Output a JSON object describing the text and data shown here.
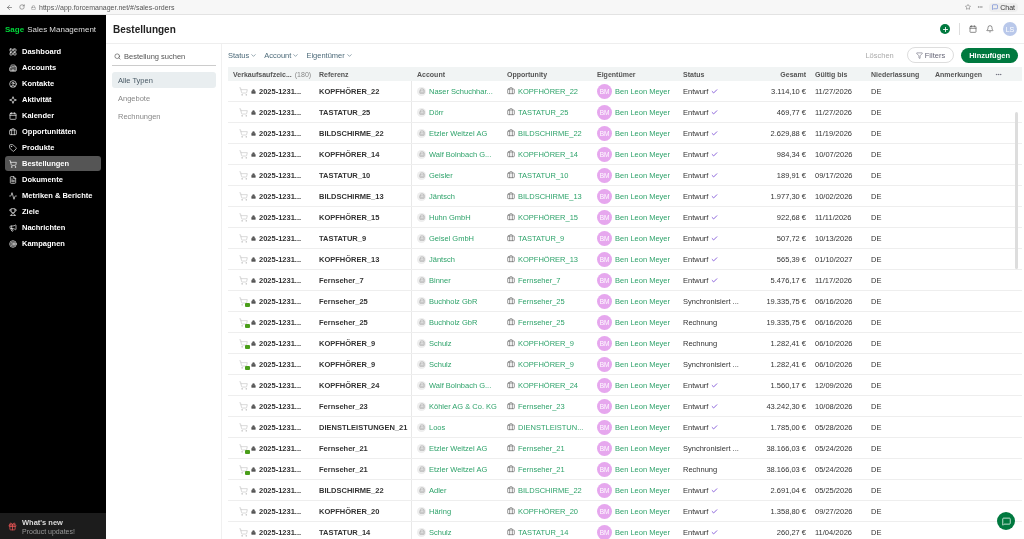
{
  "browser": {
    "url": "https://app.forcemanager.net/#/sales-orders",
    "chat_label": "Chat"
  },
  "sidebar": {
    "brand": "Sage",
    "product": "Sales Management",
    "items": [
      {
        "label": "Dashboard",
        "selected": false
      },
      {
        "label": "Accounts",
        "selected": false
      },
      {
        "label": "Kontakte",
        "selected": false
      },
      {
        "label": "Aktivität",
        "selected": false
      },
      {
        "label": "Kalender",
        "selected": false
      },
      {
        "label": "Opportunitäten",
        "selected": false
      },
      {
        "label": "Produkte",
        "selected": false
      },
      {
        "label": "Bestellungen",
        "selected": true
      },
      {
        "label": "Dokumente",
        "selected": false
      },
      {
        "label": "Metriken & Berichte",
        "selected": false
      },
      {
        "label": "Ziele",
        "selected": false
      },
      {
        "label": "Nachrichten",
        "selected": false
      },
      {
        "label": "Kampagnen",
        "selected": false
      }
    ],
    "whats_new": {
      "title": "What's new",
      "subtitle": "Product updates!"
    }
  },
  "header": {
    "title": "Bestellungen",
    "avatar": "LS"
  },
  "search": {
    "placeholder": "Bestellung suchen"
  },
  "types": [
    {
      "label": "Alle Typen",
      "selected": true
    },
    {
      "label": "Angebote",
      "selected": false
    },
    {
      "label": "Rechnungen",
      "selected": false
    }
  ],
  "filters": [
    "Status",
    "Account",
    "Eigentümer"
  ],
  "actions": {
    "delete": "Löschen",
    "delete_disabled": true,
    "filters": "Filters",
    "add": "Hinzufügen"
  },
  "table": {
    "columns": [
      "Verkaufsaufzeic...",
      "Referenz",
      "Account",
      "Opportunity",
      "Eigentümer",
      "Status",
      "Gesamt",
      "Gültig bis",
      "Niederlassung",
      "Anmerkungen"
    ],
    "count": "(180)",
    "rows": [
      {
        "code": "2025-1231...",
        "badge": false,
        "ref": "KOPFHÖRER_22",
        "account": "Naser Schuchhar...",
        "opportunity": "KOPFHÖRER_22",
        "avatar": "BM",
        "owner": "Ben Leon Meyer",
        "status": "Entwurf",
        "check": true,
        "total": "3.114,10 €",
        "valid": "11/27/2026",
        "branch": "DE"
      },
      {
        "code": "2025-1231...",
        "badge": false,
        "ref": "TASTATUR_25",
        "account": "Dörr",
        "opportunity": "TASTATUR_25",
        "avatar": "BM",
        "owner": "Ben Leon Meyer",
        "status": "Entwurf",
        "check": true,
        "total": "469,77 €",
        "valid": "11/27/2026",
        "branch": "DE"
      },
      {
        "code": "2025-1231...",
        "badge": false,
        "ref": "BILDSCHIRME_22",
        "account": "Etzler Weitzel AG",
        "opportunity": "BILDSCHIRME_22",
        "avatar": "BM",
        "owner": "Ben Leon Meyer",
        "status": "Entwurf",
        "check": true,
        "total": "2.629,88 €",
        "valid": "11/19/2026",
        "branch": "DE"
      },
      {
        "code": "2025-1231...",
        "badge": false,
        "ref": "KOPFHÖRER_14",
        "account": "Walf Bolnbach G...",
        "opportunity": "KOPFHÖRER_14",
        "avatar": "BM",
        "owner": "Ben Leon Meyer",
        "status": "Entwurf",
        "check": true,
        "total": "984,34 €",
        "valid": "10/07/2026",
        "branch": "DE"
      },
      {
        "code": "2025-1231...",
        "badge": false,
        "ref": "TASTATUR_10",
        "account": "Geisler",
        "opportunity": "TASTATUR_10",
        "avatar": "BM",
        "owner": "Ben Leon Meyer",
        "status": "Entwurf",
        "check": true,
        "total": "189,91 €",
        "valid": "09/17/2026",
        "branch": "DE"
      },
      {
        "code": "2025-1231...",
        "badge": false,
        "ref": "BILDSCHIRME_13",
        "account": "Jäntsch",
        "opportunity": "BILDSCHIRME_13",
        "avatar": "BM",
        "owner": "Ben Leon Meyer",
        "status": "Entwurf",
        "check": true,
        "total": "1.977,30 €",
        "valid": "10/02/2026",
        "branch": "DE"
      },
      {
        "code": "2025-1231...",
        "badge": false,
        "ref": "KOPFHÖRER_15",
        "account": "Huhn GmbH",
        "opportunity": "KOPFHÖRER_15",
        "avatar": "BM",
        "owner": "Ben Leon Meyer",
        "status": "Entwurf",
        "check": true,
        "total": "922,68 €",
        "valid": "11/11/2026",
        "branch": "DE"
      },
      {
        "code": "2025-1231...",
        "badge": false,
        "ref": "TASTATUR_9",
        "account": "Geisel GmbH",
        "opportunity": "TASTATUR_9",
        "avatar": "BM",
        "owner": "Ben Leon Meyer",
        "status": "Entwurf",
        "check": true,
        "total": "507,72 €",
        "valid": "10/13/2026",
        "branch": "DE"
      },
      {
        "code": "2025-1231...",
        "badge": false,
        "ref": "KOPFHÖRER_13",
        "account": "Jäntsch",
        "opportunity": "KOPFHÖRER_13",
        "avatar": "BM",
        "owner": "Ben Leon Meyer",
        "status": "Entwurf",
        "check": true,
        "total": "565,39 €",
        "valid": "01/10/2027",
        "branch": "DE"
      },
      {
        "code": "2025-1231...",
        "badge": false,
        "ref": "Fernseher_7",
        "account": "Binner",
        "opportunity": "Fernseher_7",
        "avatar": "BM",
        "owner": "Ben Leon Meyer",
        "status": "Entwurf",
        "check": true,
        "total": "5.476,17 €",
        "valid": "11/17/2026",
        "branch": "DE"
      },
      {
        "code": "2025-1231...",
        "badge": true,
        "ref": "Fernseher_25",
        "account": "Buchholz GbR",
        "opportunity": "Fernseher_25",
        "avatar": "BM",
        "owner": "Ben Leon Meyer",
        "status": "Synchronisiert ...",
        "check": false,
        "total": "19.335,75 €",
        "valid": "06/16/2026",
        "branch": "DE"
      },
      {
        "code": "2025-1231...",
        "badge": true,
        "ref": "Fernseher_25",
        "account": "Buchholz GbR",
        "opportunity": "Fernseher_25",
        "avatar": "BM",
        "owner": "Ben Leon Meyer",
        "status": "Rechnung",
        "check": false,
        "total": "19.335,75 €",
        "valid": "06/16/2026",
        "branch": "DE"
      },
      {
        "code": "2025-1231...",
        "badge": true,
        "ref": "KOPFHÖRER_9",
        "account": "Schulz",
        "opportunity": "KOPFHÖRER_9",
        "avatar": "BM",
        "owner": "Ben Leon Meyer",
        "status": "Rechnung",
        "check": false,
        "total": "1.282,41 €",
        "valid": "06/10/2026",
        "branch": "DE"
      },
      {
        "code": "2025-1231...",
        "badge": true,
        "ref": "KOPFHÖRER_9",
        "account": "Schulz",
        "opportunity": "KOPFHÖRER_9",
        "avatar": "BM",
        "owner": "Ben Leon Meyer",
        "status": "Synchronisiert ...",
        "check": false,
        "total": "1.282,41 €",
        "valid": "06/10/2026",
        "branch": "DE"
      },
      {
        "code": "2025-1231...",
        "badge": false,
        "ref": "KOPFHÖRER_24",
        "account": "Walf Bolnbach G...",
        "opportunity": "KOPFHÖRER_24",
        "avatar": "BM",
        "owner": "Ben Leon Meyer",
        "status": "Entwurf",
        "check": true,
        "total": "1.560,17 €",
        "valid": "12/09/2026",
        "branch": "DE"
      },
      {
        "code": "2025-1231...",
        "badge": false,
        "ref": "Fernseher_23",
        "account": "Köhler AG & Co. KG",
        "opportunity": "Fernseher_23",
        "avatar": "BM",
        "owner": "Ben Leon Meyer",
        "status": "Entwurf",
        "check": true,
        "total": "43.242,30 €",
        "valid": "10/08/2026",
        "branch": "DE"
      },
      {
        "code": "2025-1231...",
        "badge": false,
        "ref": "DIENSTLEISTUNGEN_21",
        "account": "Loos",
        "opportunity": "DIENSTLEISTUN...",
        "avatar": "BM",
        "owner": "Ben Leon Meyer",
        "status": "Entwurf",
        "check": true,
        "total": "1.785,00 €",
        "valid": "05/28/2026",
        "branch": "DE"
      },
      {
        "code": "2025-1231...",
        "badge": true,
        "ref": "Fernseher_21",
        "account": "Etzler Weitzel AG",
        "opportunity": "Fernseher_21",
        "avatar": "BM",
        "owner": "Ben Leon Meyer",
        "status": "Synchronisiert ...",
        "check": false,
        "total": "38.166,03 €",
        "valid": "05/24/2026",
        "branch": "DE"
      },
      {
        "code": "2025-1231...",
        "badge": true,
        "ref": "Fernseher_21",
        "account": "Etzler Weitzel AG",
        "opportunity": "Fernseher_21",
        "avatar": "BM",
        "owner": "Ben Leon Meyer",
        "status": "Rechnung",
        "check": false,
        "total": "38.166,03 €",
        "valid": "05/24/2026",
        "branch": "DE"
      },
      {
        "code": "2025-1231...",
        "badge": false,
        "ref": "BILDSCHIRME_22",
        "account": "Adler",
        "opportunity": "BILDSCHIRME_22",
        "avatar": "BM",
        "owner": "Ben Leon Meyer",
        "status": "Entwurf",
        "check": true,
        "total": "2.691,04 €",
        "valid": "05/25/2026",
        "branch": "DE"
      },
      {
        "code": "2025-1231...",
        "badge": false,
        "ref": "KOPFHÖRER_20",
        "account": "Häring",
        "opportunity": "KOPFHÖRER_20",
        "avatar": "BM",
        "owner": "Ben Leon Meyer",
        "status": "Entwurf",
        "check": true,
        "total": "1.358,80 €",
        "valid": "09/27/2026",
        "branch": "DE"
      },
      {
        "code": "2025-1231...",
        "badge": false,
        "ref": "TASTATUR_14",
        "account": "Schulz",
        "opportunity": "TASTATUR_14",
        "avatar": "BM",
        "owner": "Ben Leon Meyer",
        "status": "Entwurf",
        "check": true,
        "total": "260,27 €",
        "valid": "11/04/2026",
        "branch": "DE"
      }
    ]
  }
}
